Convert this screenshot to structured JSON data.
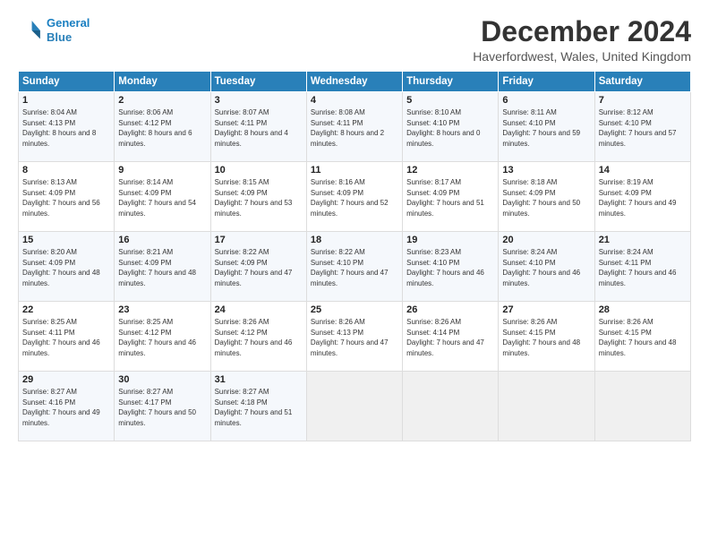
{
  "logo": {
    "line1": "General",
    "line2": "Blue"
  },
  "title": "December 2024",
  "location": "Haverfordwest, Wales, United Kingdom",
  "headers": [
    "Sunday",
    "Monday",
    "Tuesday",
    "Wednesday",
    "Thursday",
    "Friday",
    "Saturday"
  ],
  "weeks": [
    [
      {
        "day": "1",
        "sunrise": "Sunrise: 8:04 AM",
        "sunset": "Sunset: 4:13 PM",
        "daylight": "Daylight: 8 hours and 8 minutes."
      },
      {
        "day": "2",
        "sunrise": "Sunrise: 8:06 AM",
        "sunset": "Sunset: 4:12 PM",
        "daylight": "Daylight: 8 hours and 6 minutes."
      },
      {
        "day": "3",
        "sunrise": "Sunrise: 8:07 AM",
        "sunset": "Sunset: 4:11 PM",
        "daylight": "Daylight: 8 hours and 4 minutes."
      },
      {
        "day": "4",
        "sunrise": "Sunrise: 8:08 AM",
        "sunset": "Sunset: 4:11 PM",
        "daylight": "Daylight: 8 hours and 2 minutes."
      },
      {
        "day": "5",
        "sunrise": "Sunrise: 8:10 AM",
        "sunset": "Sunset: 4:10 PM",
        "daylight": "Daylight: 8 hours and 0 minutes."
      },
      {
        "day": "6",
        "sunrise": "Sunrise: 8:11 AM",
        "sunset": "Sunset: 4:10 PM",
        "daylight": "Daylight: 7 hours and 59 minutes."
      },
      {
        "day": "7",
        "sunrise": "Sunrise: 8:12 AM",
        "sunset": "Sunset: 4:10 PM",
        "daylight": "Daylight: 7 hours and 57 minutes."
      }
    ],
    [
      {
        "day": "8",
        "sunrise": "Sunrise: 8:13 AM",
        "sunset": "Sunset: 4:09 PM",
        "daylight": "Daylight: 7 hours and 56 minutes."
      },
      {
        "day": "9",
        "sunrise": "Sunrise: 8:14 AM",
        "sunset": "Sunset: 4:09 PM",
        "daylight": "Daylight: 7 hours and 54 minutes."
      },
      {
        "day": "10",
        "sunrise": "Sunrise: 8:15 AM",
        "sunset": "Sunset: 4:09 PM",
        "daylight": "Daylight: 7 hours and 53 minutes."
      },
      {
        "day": "11",
        "sunrise": "Sunrise: 8:16 AM",
        "sunset": "Sunset: 4:09 PM",
        "daylight": "Daylight: 7 hours and 52 minutes."
      },
      {
        "day": "12",
        "sunrise": "Sunrise: 8:17 AM",
        "sunset": "Sunset: 4:09 PM",
        "daylight": "Daylight: 7 hours and 51 minutes."
      },
      {
        "day": "13",
        "sunrise": "Sunrise: 8:18 AM",
        "sunset": "Sunset: 4:09 PM",
        "daylight": "Daylight: 7 hours and 50 minutes."
      },
      {
        "day": "14",
        "sunrise": "Sunrise: 8:19 AM",
        "sunset": "Sunset: 4:09 PM",
        "daylight": "Daylight: 7 hours and 49 minutes."
      }
    ],
    [
      {
        "day": "15",
        "sunrise": "Sunrise: 8:20 AM",
        "sunset": "Sunset: 4:09 PM",
        "daylight": "Daylight: 7 hours and 48 minutes."
      },
      {
        "day": "16",
        "sunrise": "Sunrise: 8:21 AM",
        "sunset": "Sunset: 4:09 PM",
        "daylight": "Daylight: 7 hours and 48 minutes."
      },
      {
        "day": "17",
        "sunrise": "Sunrise: 8:22 AM",
        "sunset": "Sunset: 4:09 PM",
        "daylight": "Daylight: 7 hours and 47 minutes."
      },
      {
        "day": "18",
        "sunrise": "Sunrise: 8:22 AM",
        "sunset": "Sunset: 4:10 PM",
        "daylight": "Daylight: 7 hours and 47 minutes."
      },
      {
        "day": "19",
        "sunrise": "Sunrise: 8:23 AM",
        "sunset": "Sunset: 4:10 PM",
        "daylight": "Daylight: 7 hours and 46 minutes."
      },
      {
        "day": "20",
        "sunrise": "Sunrise: 8:24 AM",
        "sunset": "Sunset: 4:10 PM",
        "daylight": "Daylight: 7 hours and 46 minutes."
      },
      {
        "day": "21",
        "sunrise": "Sunrise: 8:24 AM",
        "sunset": "Sunset: 4:11 PM",
        "daylight": "Daylight: 7 hours and 46 minutes."
      }
    ],
    [
      {
        "day": "22",
        "sunrise": "Sunrise: 8:25 AM",
        "sunset": "Sunset: 4:11 PM",
        "daylight": "Daylight: 7 hours and 46 minutes."
      },
      {
        "day": "23",
        "sunrise": "Sunrise: 8:25 AM",
        "sunset": "Sunset: 4:12 PM",
        "daylight": "Daylight: 7 hours and 46 minutes."
      },
      {
        "day": "24",
        "sunrise": "Sunrise: 8:26 AM",
        "sunset": "Sunset: 4:12 PM",
        "daylight": "Daylight: 7 hours and 46 minutes."
      },
      {
        "day": "25",
        "sunrise": "Sunrise: 8:26 AM",
        "sunset": "Sunset: 4:13 PM",
        "daylight": "Daylight: 7 hours and 47 minutes."
      },
      {
        "day": "26",
        "sunrise": "Sunrise: 8:26 AM",
        "sunset": "Sunset: 4:14 PM",
        "daylight": "Daylight: 7 hours and 47 minutes."
      },
      {
        "day": "27",
        "sunrise": "Sunrise: 8:26 AM",
        "sunset": "Sunset: 4:15 PM",
        "daylight": "Daylight: 7 hours and 48 minutes."
      },
      {
        "day": "28",
        "sunrise": "Sunrise: 8:26 AM",
        "sunset": "Sunset: 4:15 PM",
        "daylight": "Daylight: 7 hours and 48 minutes."
      }
    ],
    [
      {
        "day": "29",
        "sunrise": "Sunrise: 8:27 AM",
        "sunset": "Sunset: 4:16 PM",
        "daylight": "Daylight: 7 hours and 49 minutes."
      },
      {
        "day": "30",
        "sunrise": "Sunrise: 8:27 AM",
        "sunset": "Sunset: 4:17 PM",
        "daylight": "Daylight: 7 hours and 50 minutes."
      },
      {
        "day": "31",
        "sunrise": "Sunrise: 8:27 AM",
        "sunset": "Sunset: 4:18 PM",
        "daylight": "Daylight: 7 hours and 51 minutes."
      },
      null,
      null,
      null,
      null
    ]
  ]
}
